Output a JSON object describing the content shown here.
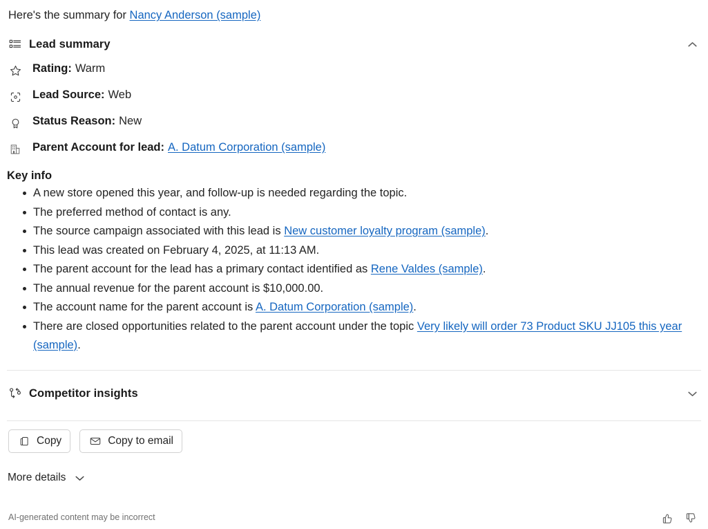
{
  "intro": {
    "prefix": "Here's the summary for ",
    "link": "Nancy Anderson (sample)"
  },
  "lead_summary": {
    "icon": "list-icon",
    "title": "Lead summary",
    "chevron": "chevron-up-icon",
    "expanded": true,
    "attributes": [
      {
        "icon": "star-icon",
        "label": "Rating:",
        "value": "Warm"
      },
      {
        "icon": "target-icon",
        "label": "Lead Source:",
        "value": "Web"
      },
      {
        "icon": "award-icon",
        "label": "Status Reason:",
        "value": "New"
      },
      {
        "icon": "building-icon",
        "label": "Parent Account for lead:",
        "link": "A. Datum Corporation (sample)"
      }
    ]
  },
  "key_info": {
    "title": "Key info",
    "bullets": [
      {
        "parts": [
          {
            "t": "A new store opened this year, and follow-up is needed regarding the topic."
          }
        ]
      },
      {
        "parts": [
          {
            "t": "The preferred method of contact is any."
          }
        ]
      },
      {
        "parts": [
          {
            "t": "The source campaign associated with this lead is "
          },
          {
            "t": "New customer loyalty program (sample)",
            "link": true
          },
          {
            "t": "."
          }
        ]
      },
      {
        "parts": [
          {
            "t": "This lead was created on February 4, 2025, at 11:13 AM."
          }
        ]
      },
      {
        "parts": [
          {
            "t": "The parent account for the lead has a primary contact identified as "
          },
          {
            "t": "Rene Valdes (sample)",
            "link": true
          },
          {
            "t": "."
          }
        ]
      },
      {
        "parts": [
          {
            "t": "The annual revenue for the parent account is $10,000.00."
          }
        ]
      },
      {
        "parts": [
          {
            "t": "The account name for the parent account is "
          },
          {
            "t": "A. Datum Corporation (sample)",
            "link": true
          },
          {
            "t": "."
          }
        ]
      },
      {
        "parts": [
          {
            "t": "There are closed opportunities related to the parent account under the topic "
          },
          {
            "t": "Very likely will order 73 Product SKU JJ105 this year (sample)",
            "link": true
          },
          {
            "t": "."
          }
        ]
      }
    ]
  },
  "competitor_insights": {
    "icon": "compare-branch-icon",
    "title": "Competitor insights",
    "chevron": "chevron-down-icon",
    "expanded": false
  },
  "actions": {
    "copy": {
      "icon": "copy-icon",
      "label": "Copy"
    },
    "copy_to_email": {
      "icon": "envelope-icon",
      "label": "Copy to email"
    }
  },
  "more_details": {
    "label": "More details",
    "icon": "chevron-down-icon"
  },
  "footer": {
    "disclaimer": "AI-generated content may be incorrect",
    "thumbs_up": "thumbs-up-icon",
    "thumbs_down": "thumbs-down-icon"
  },
  "colors": {
    "link": "#1566c0",
    "text": "#242424",
    "muted": "#707070",
    "divider": "#e6e6e6",
    "border": "#d1d1d1"
  }
}
